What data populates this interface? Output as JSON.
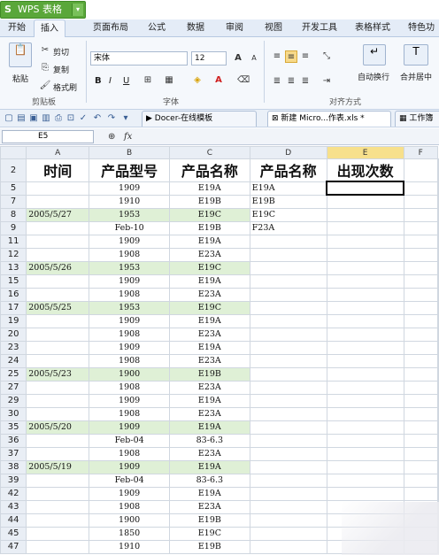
{
  "app": {
    "name": "WPS 表格",
    "logo": "S"
  },
  "menu": [
    "开始",
    "插入",
    "页面布局",
    "公式",
    "数据",
    "审阅",
    "视图",
    "开发工具",
    "表格样式",
    "特色功"
  ],
  "active_menu_index": 1,
  "ribbon": {
    "paste_label": "粘贴",
    "cut_label": "剪切",
    "copy_label": "复制",
    "format_painter_label": "格式刷",
    "clipboard_group": "剪贴板",
    "font_name": "宋体",
    "font_size": "12",
    "font_group": "字体",
    "bold": "B",
    "italic": "I",
    "underline": "U",
    "wrap_label": "自动换行",
    "merge_label": "合并居中",
    "align_group": "对齐方式"
  },
  "doc_tabs": [
    "Docer-在线模板",
    "新建 Micro...作表.xls *",
    "工作簿"
  ],
  "formula_bar": {
    "cell_ref": "E5",
    "fx": "fx",
    "value": ""
  },
  "columns": [
    "A",
    "B",
    "C",
    "D",
    "E",
    "F"
  ],
  "selected_column": "E",
  "header_row": {
    "row": "2",
    "cells": [
      "时间",
      "产品型号",
      "产品名称",
      "产品名称",
      "出现次数",
      ""
    ]
  },
  "rows": [
    {
      "row": "5",
      "cells": [
        "",
        "1909",
        "E19A",
        "E19A",
        "",
        ""
      ],
      "green": false
    },
    {
      "row": "7",
      "cells": [
        "",
        "1910",
        "E19B",
        "E19B",
        "",
        ""
      ],
      "green": false
    },
    {
      "row": "8",
      "cells": [
        "2005/5/27",
        "1953",
        "E19C",
        "E19C",
        "",
        ""
      ],
      "green": true
    },
    {
      "row": "9",
      "cells": [
        "",
        "Feb-10",
        "E19B",
        "F23A",
        "",
        ""
      ],
      "green": false
    },
    {
      "row": "11",
      "cells": [
        "",
        "1909",
        "E19A",
        "",
        "",
        ""
      ],
      "green": false
    },
    {
      "row": "12",
      "cells": [
        "",
        "1908",
        "E23A",
        "",
        "",
        ""
      ],
      "green": false
    },
    {
      "row": "13",
      "cells": [
        "2005/5/26",
        "1953",
        "E19C",
        "",
        "",
        ""
      ],
      "green": true
    },
    {
      "row": "15",
      "cells": [
        "",
        "1909",
        "E19A",
        "",
        "",
        ""
      ],
      "green": false
    },
    {
      "row": "16",
      "cells": [
        "",
        "1908",
        "E23A",
        "",
        "",
        ""
      ],
      "green": false
    },
    {
      "row": "17",
      "cells": [
        "2005/5/25",
        "1953",
        "E19C",
        "",
        "",
        ""
      ],
      "green": true
    },
    {
      "row": "19",
      "cells": [
        "",
        "1909",
        "E19A",
        "",
        "",
        ""
      ],
      "green": false
    },
    {
      "row": "20",
      "cells": [
        "",
        "1908",
        "E23A",
        "",
        "",
        ""
      ],
      "green": false
    },
    {
      "row": "23",
      "cells": [
        "",
        "1909",
        "E19A",
        "",
        "",
        ""
      ],
      "green": false
    },
    {
      "row": "24",
      "cells": [
        "",
        "1908",
        "E23A",
        "",
        "",
        ""
      ],
      "green": false
    },
    {
      "row": "25",
      "cells": [
        "2005/5/23",
        "1900",
        "E19B",
        "",
        "",
        ""
      ],
      "green": true
    },
    {
      "row": "27",
      "cells": [
        "",
        "1908",
        "E23A",
        "",
        "",
        ""
      ],
      "green": false
    },
    {
      "row": "29",
      "cells": [
        "",
        "1909",
        "E19A",
        "",
        "",
        ""
      ],
      "green": false
    },
    {
      "row": "30",
      "cells": [
        "",
        "1908",
        "E23A",
        "",
        "",
        ""
      ],
      "green": false
    },
    {
      "row": "35",
      "cells": [
        "2005/5/20",
        "1909",
        "E19A",
        "",
        "",
        ""
      ],
      "green": true
    },
    {
      "row": "36",
      "cells": [
        "",
        "Feb-04",
        "83-6.3",
        "",
        "",
        ""
      ],
      "green": false
    },
    {
      "row": "37",
      "cells": [
        "",
        "1908",
        "E23A",
        "",
        "",
        ""
      ],
      "green": false
    },
    {
      "row": "38",
      "cells": [
        "2005/5/19",
        "1909",
        "E19A",
        "",
        "",
        ""
      ],
      "green": true
    },
    {
      "row": "39",
      "cells": [
        "",
        "Feb-04",
        "83-6.3",
        "",
        "",
        ""
      ],
      "green": false
    },
    {
      "row": "42",
      "cells": [
        "",
        "1909",
        "E19A",
        "",
        "",
        ""
      ],
      "green": false
    },
    {
      "row": "43",
      "cells": [
        "",
        "1908",
        "E23A",
        "",
        "",
        ""
      ],
      "green": false
    },
    {
      "row": "44",
      "cells": [
        "",
        "1900",
        "E19B",
        "",
        "",
        ""
      ],
      "green": false
    },
    {
      "row": "45",
      "cells": [
        "",
        "1850",
        "E19C",
        "",
        "",
        ""
      ],
      "green": false
    },
    {
      "row": "47",
      "cells": [
        "",
        "1910",
        "E19B",
        "",
        "",
        ""
      ],
      "green": false
    }
  ],
  "colors": {
    "app_green": "#5aa73a",
    "row_highlight": "#dff0d6",
    "selected_col_header": "#f7e08c"
  }
}
